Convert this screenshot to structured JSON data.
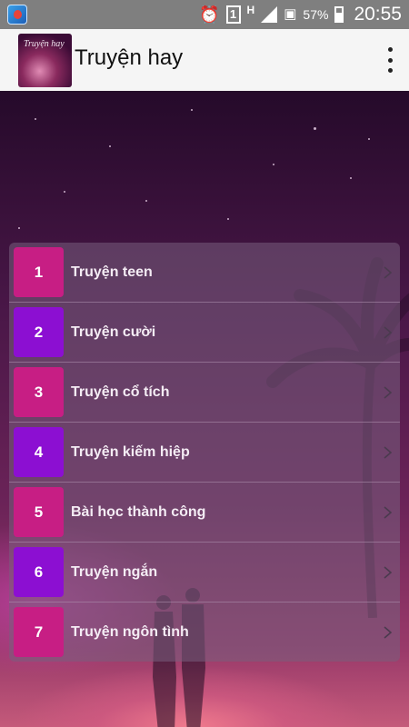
{
  "status_bar": {
    "alarm_icon": "alarm-clock-icon",
    "sim_label": "1",
    "network_label": "H",
    "battery_percent": "57%",
    "time": "20:55"
  },
  "app_bar": {
    "logo_text": "Truyện hay",
    "title": "Truyện hay",
    "menu_icon": "more-vert-icon"
  },
  "colors": {
    "magenta": "#c71e84",
    "purple": "#8c0fd2"
  },
  "menu": {
    "items": [
      {
        "number": "1",
        "label": "Truyện teen",
        "color": "#c71e84"
      },
      {
        "number": "2",
        "label": "Truyện cười",
        "color": "#8c0fd2"
      },
      {
        "number": "3",
        "label": "Truyện cổ tích",
        "color": "#c71e84"
      },
      {
        "number": "4",
        "label": "Truyện kiếm hiệp",
        "color": "#8c0fd2"
      },
      {
        "number": "5",
        "label": "Bài học thành công",
        "color": "#c71e84"
      },
      {
        "number": "6",
        "label": "Truyện ngắn",
        "color": "#8c0fd2"
      },
      {
        "number": "7",
        "label": "Truyện ngôn tình",
        "color": "#c71e84"
      }
    ]
  }
}
